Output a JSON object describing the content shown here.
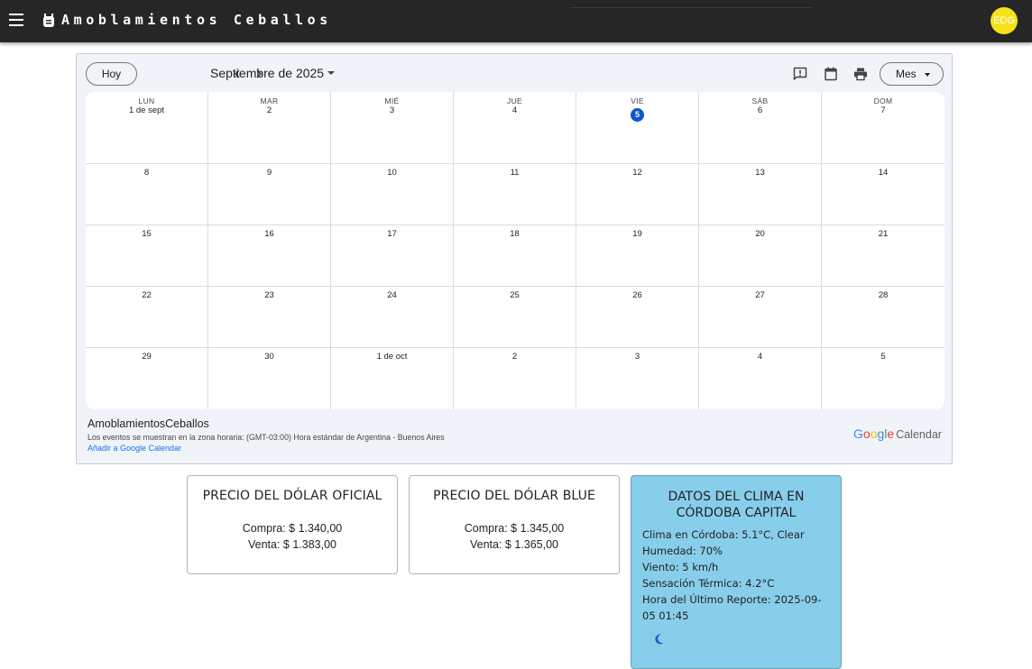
{
  "header": {
    "title": "Amoblamientos Ceballos",
    "avatar_initials": "EDG",
    "bar_color": "#262626",
    "avatar_color": "#f7e11a"
  },
  "calendar": {
    "today_button": "Hoy",
    "month_label": "Septiembre de 2025",
    "view_button": "Mes",
    "weekdays": [
      "LUN",
      "MAR",
      "MIÉ",
      "JUE",
      "VIE",
      "SÁB",
      "DOM"
    ],
    "weeks": [
      [
        "1 de sept",
        "2",
        "3",
        "4",
        "5",
        "6",
        "7"
      ],
      [
        "8",
        "9",
        "10",
        "11",
        "12",
        "13",
        "14"
      ],
      [
        "15",
        "16",
        "17",
        "18",
        "19",
        "20",
        "21"
      ],
      [
        "22",
        "23",
        "24",
        "25",
        "26",
        "27",
        "28"
      ],
      [
        "29",
        "30",
        "1 de oct",
        "2",
        "3",
        "4",
        "5"
      ]
    ],
    "today": "5",
    "today_color": "#0b57d0",
    "calendar_name": "AmoblamientosCeballos",
    "timezone_note": "Los eventos se muestran en la zona horaria: (GMT-03:00) Hora estándar de Argentina - Buenos Aires",
    "add_link": "Añadir a Google Calendar",
    "logo_google": "Google",
    "logo_calendar": "Calendar"
  },
  "dolar_oficial": {
    "title": "PRECIO DEL DÓLAR OFICIAL",
    "compra": "Compra: $ 1.340,00",
    "venta": "Venta: $ 1.383,00"
  },
  "dolar_blue": {
    "title": "PRECIO DEL DÓLAR BLUE",
    "compra": "Compra: $ 1.345,00",
    "venta": "Venta: $ 1.365,00"
  },
  "weather": {
    "title": "DATOS DEL CLIMA EN CÓRDOBA CAPITAL",
    "clima": "Clima en Córdoba: 5.1°C, Clear",
    "humedad": "Humedad: 70%",
    "viento": "Viento: 5 km/h",
    "sensacion": "Sensación Térmica: 4.2°C",
    "reporte": "Hora del Último Reporte: 2025-09-05 01:45",
    "icon": "moon-icon",
    "bg_color": "#87ceeb"
  }
}
